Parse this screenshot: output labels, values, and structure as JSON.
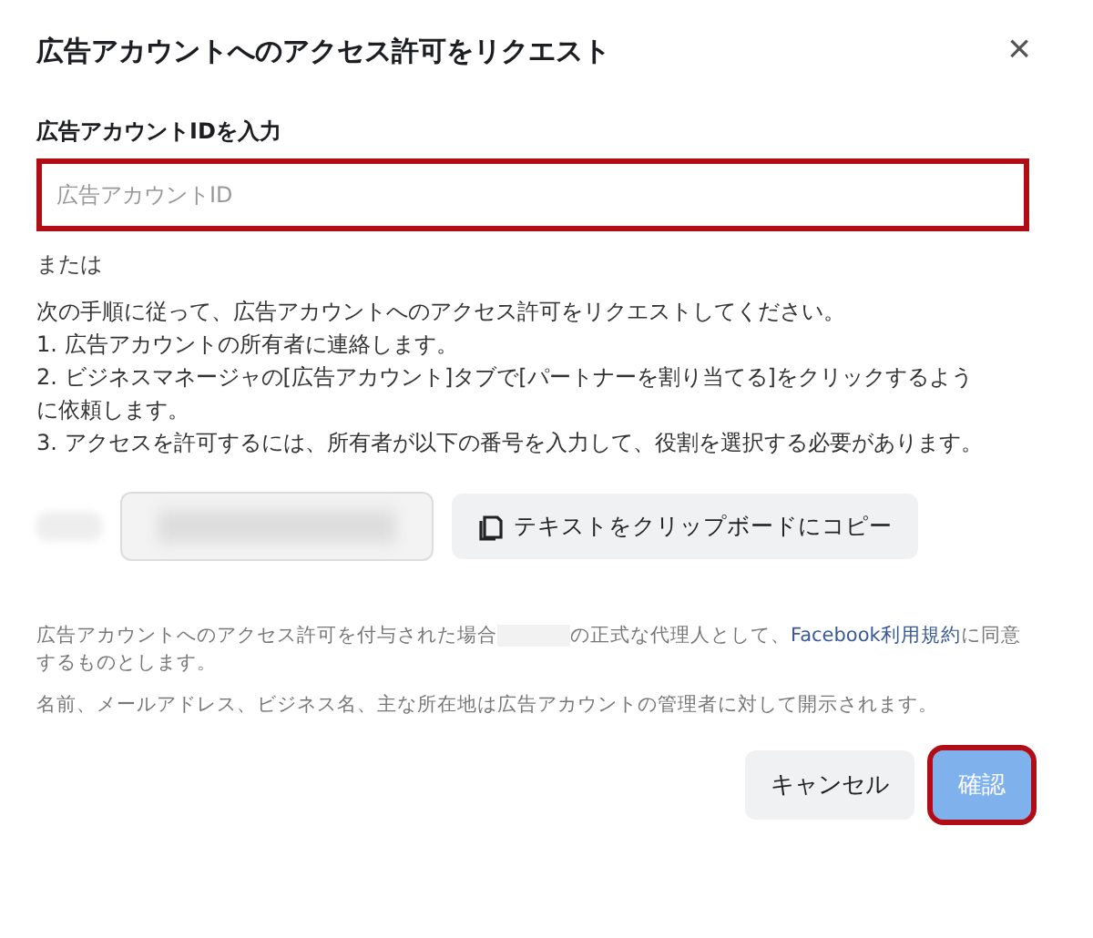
{
  "dialog": {
    "title": "広告アカウントへのアクセス許可をリクエスト",
    "close": "×"
  },
  "account_id": {
    "label": "広告アカウントIDを入力",
    "placeholder": "広告アカウントID",
    "highlighted": true
  },
  "or_text": "または",
  "instructions": [
    "次の手順に従って、広告アカウントへのアクセス許可をリクエストしてください。",
    "1. 広告アカウントの所有者に連絡します。",
    "2. ビジネスマネージャの[広告アカウント]タブで[パートナーを割り当てる]をクリックするように依頼します。",
    "3. アクセスを許可するには、所有者が以下の番号を入力して、役割を選択する必要があります。"
  ],
  "copy_button": "テキストをクリップボードにコピー",
  "terms": {
    "before": "広告アカウントへのアクセス許可を付与された場合",
    "after": "の正式な代理人として、",
    "link": "Facebook利用規約",
    "end": "に同意するものとします。"
  },
  "disclosure": "名前、メールアドレス、ビジネス名、主な所在地は広告アカウントの管理者に対して開示されます。",
  "buttons": [
    {
      "label": "キャンセル",
      "kind": "secondary",
      "disabled": false,
      "highlighted": false
    },
    {
      "label": "確認",
      "kind": "primary",
      "disabled": true,
      "highlighted": true
    }
  ]
}
